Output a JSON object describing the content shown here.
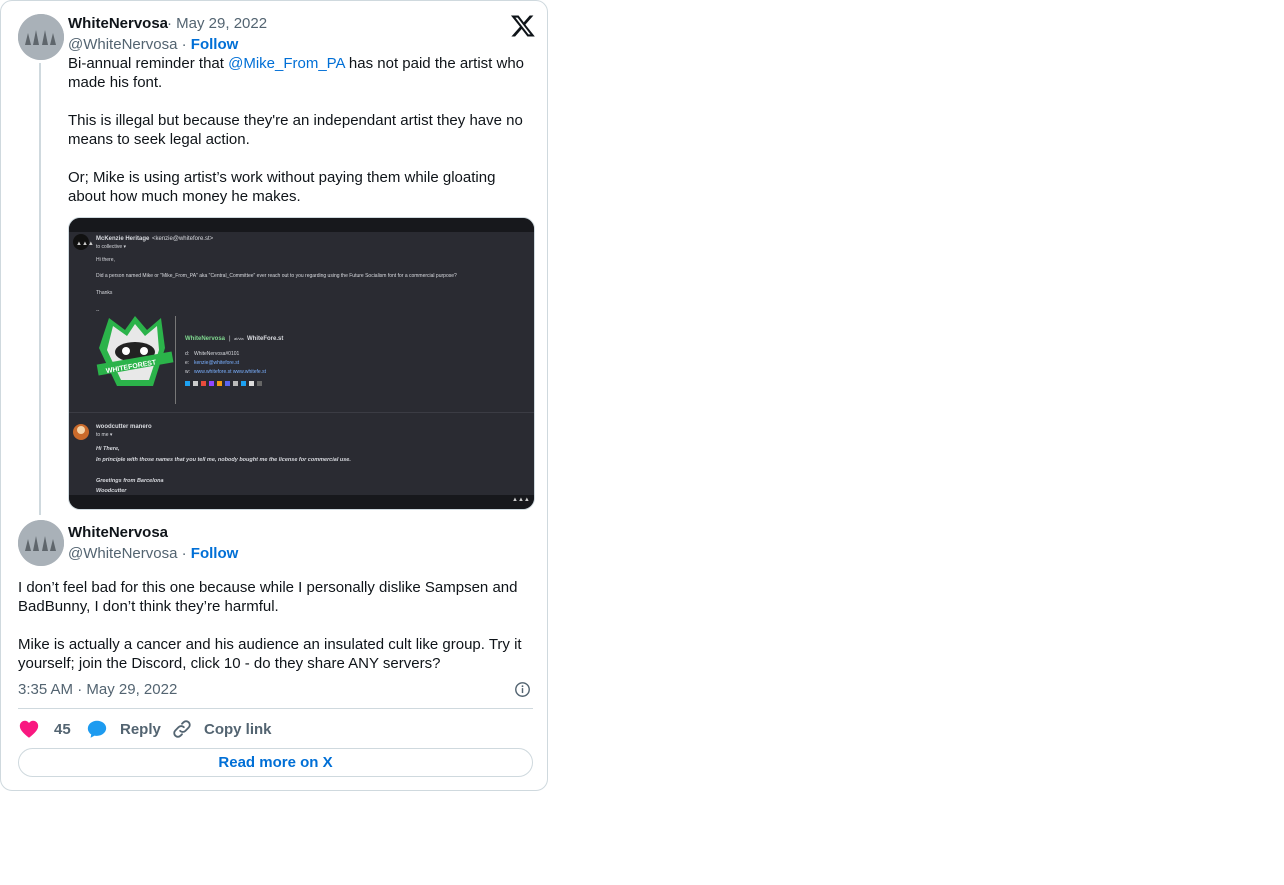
{
  "tweet1": {
    "name": "WhiteNervosa",
    "date": "May 29, 2022",
    "handle": "@WhiteNervosa",
    "follow": "Follow",
    "text_pre": "Bi-annual reminder that ",
    "mention": "@Mike_From_PA",
    "text_post": " has not paid the artist who made his font.\n\nThis is illegal but because they're an independant artist they have no means to seek legal action.\n\nOr; Mike is using artist’s work without paying them while gloating about how much money he makes."
  },
  "media": {
    "sender1": "McKenzie Heritage",
    "sender1_email": "<kenzie@whitefore.st>",
    "to1": "to collective ▾",
    "greeting": "Hi there,",
    "body1": "Did a person named Mike           or \"Mike_From_PA\" aka \"Central_Committee\" ever reach out to you regarding using the Future Socialism font for a commercial purpose?",
    "thanks": "Thanks",
    "sig_dash": "--",
    "badge_text": "WHITEFOREST",
    "sig_name": "WhiteNervosa",
    "sig_sep": "|",
    "sig_at": "at/via",
    "sig_company": "WhiteFore.st",
    "sig_d_label": "d:",
    "sig_d": "WhiteNervosa#0101",
    "sig_e_label": "e:",
    "sig_e": "kenzie@whitefore.st",
    "sig_w_label": "w:",
    "sig_w": "www.whitefore.st  www.whitefe.st",
    "sender2": "woodcutter manero",
    "to2": "to me ▾",
    "reply1": "Hi There,",
    "reply2": "In principle with those names that you tell me, nobody bought me the license for commercial use.",
    "reply3": "Greetings from Barcelona",
    "reply4": "Woodcutter"
  },
  "tweet2": {
    "name": "WhiteNervosa",
    "handle": "@WhiteNervosa",
    "follow": "Follow",
    "text": "I don’t feel bad for this one because while I personally dislike Sampsen and BadBunny, I don’t think they’re harmful.\n\nMike is actually a cancer and his audience an insulated cult like group. Try it yourself; join the Discord, click 10 - do they share ANY servers?",
    "time": "3:35 AM",
    "date": "May 29, 2022"
  },
  "actions": {
    "likes": "45",
    "reply": "Reply",
    "copy": "Copy link",
    "read_more": "Read more on X"
  },
  "colors": {
    "link": "#006fd6",
    "like": "#f91880",
    "reply": "#1d9bf0",
    "border": "#cfd9de",
    "muted": "#536471"
  }
}
